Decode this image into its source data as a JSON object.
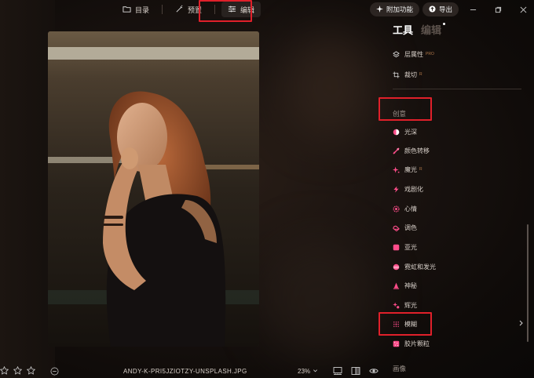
{
  "topnav": {
    "catalog_label": "目录",
    "preset_label": "预置",
    "edit_label": "编辑"
  },
  "topright": {
    "addons_label": "附加功能",
    "export_label": "导出"
  },
  "panel": {
    "tab_tools": "工具",
    "tab_edit": "编辑",
    "basic_items": [
      {
        "label": "层属性",
        "badge": "PRO",
        "icon": "layers-icon"
      },
      {
        "label": "裁切",
        "badge": "R",
        "icon": "crop-icon"
      }
    ],
    "creative_title": "创意",
    "creative_items": [
      {
        "label": "光深",
        "icon": "light-depth-icon",
        "color": "#ff4d8a"
      },
      {
        "label": "颜色转移",
        "icon": "color-transfer-icon",
        "color": "#ff4d8a"
      },
      {
        "label": "魔光",
        "badge": "R",
        "icon": "magic-light-icon",
        "color": "#ff4d8a"
      },
      {
        "label": "戏剧化",
        "icon": "dramatic-icon",
        "color": "#ff4d8a"
      },
      {
        "label": "心情",
        "icon": "mood-icon",
        "color": "#ff4d8a"
      },
      {
        "label": "调色",
        "icon": "toning-icon",
        "color": "#ff4d8a"
      },
      {
        "label": "亚光",
        "icon": "matte-icon",
        "color": "#ff4d8a"
      },
      {
        "label": "霓虹和发光",
        "icon": "neon-glow-icon",
        "color": "#ff4d8a"
      },
      {
        "label": "神秘",
        "icon": "mystical-icon",
        "color": "#ff4d8a"
      },
      {
        "label": "辉光",
        "icon": "glow-icon",
        "color": "#ff4d8a"
      },
      {
        "label": "模糊",
        "icon": "blur-icon",
        "color": "#ff4d8a"
      },
      {
        "label": "胶片颗粒",
        "icon": "film-grain-icon",
        "color": "#ff4d8a"
      }
    ],
    "image_title": "画像"
  },
  "bottom": {
    "filename": "ANDY-K-PRI5JZIOTZY-UNSPLASH.JPG",
    "zoom": "23%"
  },
  "colors": {
    "highlight": "#e0202a",
    "accent_pink": "#ff4d8a"
  }
}
